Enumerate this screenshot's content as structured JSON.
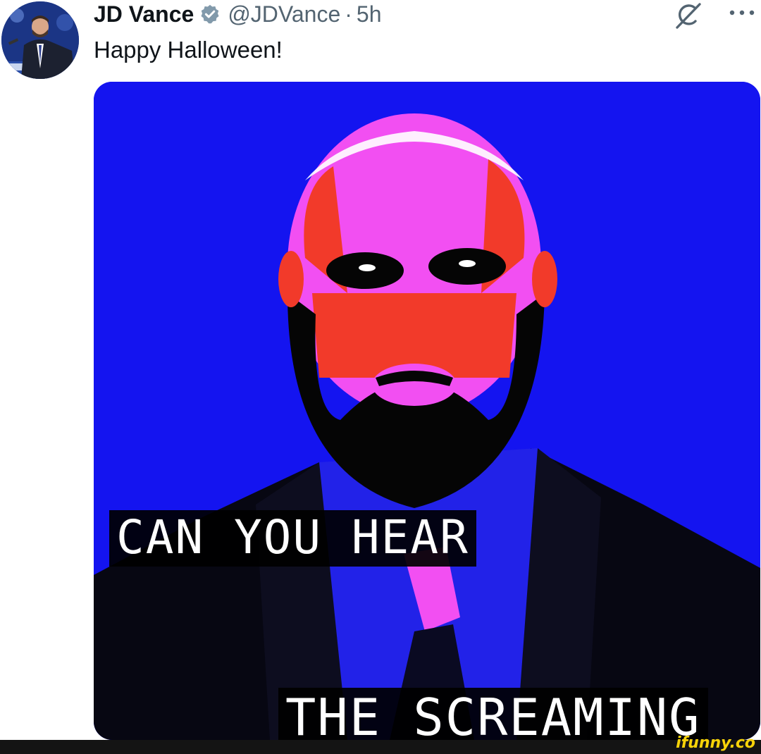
{
  "tweet": {
    "author_name": "JD Vance",
    "handle": "@JDVance",
    "separator": "·",
    "time": "5h",
    "text": "Happy Halloween!"
  },
  "icons": {
    "verified": "verified-badge-icon",
    "grok": "grok-icon",
    "more": "more-options-icon"
  },
  "media": {
    "caption_top": "CAN YOU HEAR",
    "caption_bottom": "THE SCREAMING"
  },
  "footer": {
    "watermark": "ifunny.co"
  },
  "colors": {
    "background": "#ffffff",
    "text_primary": "#0f1419",
    "text_secondary": "#536471",
    "verified": "#829aab",
    "media_blue": "#1414f0",
    "face_magenta": "#f24ff2",
    "face_red": "#f23a2a",
    "watermark": "#f7d308"
  }
}
